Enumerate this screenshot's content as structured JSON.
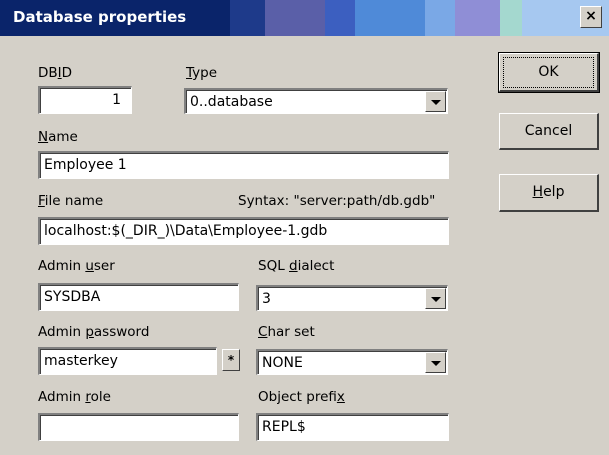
{
  "window": {
    "title": "Database properties",
    "close_glyph": "×"
  },
  "fields": {
    "dbid": {
      "label_pre": "DB",
      "label_u": "I",
      "label_post": "D",
      "value": "1"
    },
    "type": {
      "label_pre": "",
      "label_u": "T",
      "label_post": "ype",
      "value": "0..database"
    },
    "name": {
      "label_pre": "",
      "label_u": "N",
      "label_post": "ame",
      "value": "Employee 1"
    },
    "file_name": {
      "label_pre": "",
      "label_u": "F",
      "label_post": "ile name",
      "value": "localhost:$(_DIR_)\\Data\\Employee-1.gdb"
    },
    "syntax_hint": "Syntax: \"server:path/db.gdb\"",
    "admin_user": {
      "label_pre": "Admin ",
      "label_u": "u",
      "label_post": "ser",
      "value": "SYSDBA"
    },
    "sql_dialect": {
      "label_pre": "SQL ",
      "label_u": "d",
      "label_post": "ialect",
      "value": "3"
    },
    "admin_password": {
      "label_pre": "Admin ",
      "label_u": "p",
      "label_post": "assword",
      "value": "masterkey",
      "button": "*"
    },
    "char_set": {
      "label_pre": "",
      "label_u": "C",
      "label_post": "har set",
      "value": "NONE"
    },
    "admin_role": {
      "label_pre": "Admin ",
      "label_u": "r",
      "label_post": "ole",
      "value": ""
    },
    "object_prefix": {
      "label_pre": "Object prefi",
      "label_u": "x",
      "label_post": "",
      "value": "REPL$"
    }
  },
  "buttons": {
    "ok": "OK",
    "cancel": "Cancel",
    "help_u": "H",
    "help_post": "elp"
  },
  "colors": {
    "title_bg": "#0a246a",
    "dialog_bg": "#d4d0c8"
  }
}
